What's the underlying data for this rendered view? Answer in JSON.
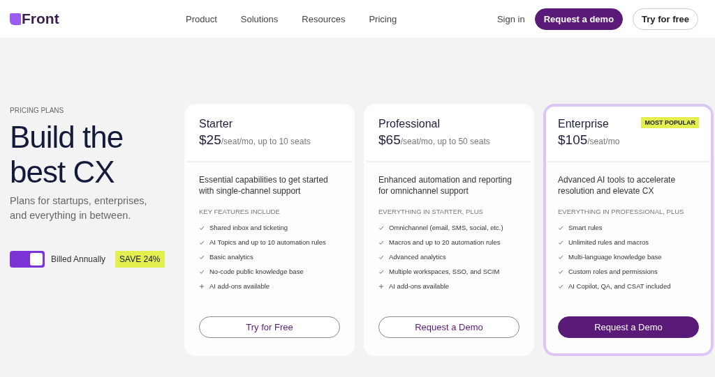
{
  "header": {
    "logo": "Front",
    "nav": [
      "Product",
      "Solutions",
      "Resources",
      "Pricing"
    ],
    "sign_in": "Sign in",
    "buttons": [
      {
        "label": "Request a demo",
        "primary": true
      },
      {
        "label": "Try for free",
        "primary": false
      }
    ]
  },
  "intro": {
    "eyebrow": "PRICING PLANS",
    "heading": "Build the best CX",
    "subheading": "Plans for startups, enterprises, and everything in between.",
    "billing_toggle": {
      "on": true,
      "label": "Billed Annually"
    },
    "badge": "SAVE 24%"
  },
  "plans": [
    {
      "name": "Starter",
      "price": "$25",
      "unit": "/seat/mo, up to 10 seats",
      "highlighted": false,
      "description": "Essential capabilities to get started with single-channel support",
      "features_heading": "KEY FEATURES INCLUDE",
      "features": [
        {
          "kind": "check",
          "text": "Shared inbox and ticketing"
        },
        {
          "kind": "check",
          "text": "AI Topics and up to 10 automation rules"
        },
        {
          "kind": "check",
          "text": "Basic analytics"
        },
        {
          "kind": "check",
          "text": "No-code public knowledge base"
        },
        {
          "kind": "plus",
          "text": "AI add-ons available"
        }
      ],
      "button": {
        "label": "Try for Free",
        "primary": false
      }
    },
    {
      "name": "Professional",
      "price": "$65",
      "unit": "/seat/mo, up to 50 seats",
      "highlighted": false,
      "description": "Enhanced automation and reporting for omnichannel support",
      "features_heading": "EVERYTHING IN STARTER, PLUS",
      "features": [
        {
          "kind": "check",
          "text": "Omnichannel (email, SMS, social, etc.)"
        },
        {
          "kind": "check",
          "text": "Macros and up to 20 automation rules"
        },
        {
          "kind": "check",
          "text": "Advanced analytics"
        },
        {
          "kind": "check",
          "text": "Multiple workspaces, SSO, and SCIM"
        },
        {
          "kind": "plus",
          "text": "AI add-ons available"
        }
      ],
      "button": {
        "label": "Request a Demo",
        "primary": false
      }
    },
    {
      "name": "Enterprise",
      "price": "$105",
      "unit": "/seat/mo",
      "badge": "MOST POPULAR",
      "highlighted": true,
      "description": "Advanced AI tools to accelerate resolution and elevate CX",
      "features_heading": "EVERYTHING IN PROFESSIONAL, PLUS",
      "features": [
        {
          "kind": "check",
          "text": "Smart rules"
        },
        {
          "kind": "check",
          "text": "Unlimited rules and macros"
        },
        {
          "kind": "check",
          "text": "Multi-language knowledge base"
        },
        {
          "kind": "check",
          "text": "Custom roles and permissions"
        },
        {
          "kind": "check",
          "text": "AI Copilot, QA, and CSAT included"
        }
      ],
      "button": {
        "label": "Request a Demo",
        "primary": true
      }
    }
  ]
}
